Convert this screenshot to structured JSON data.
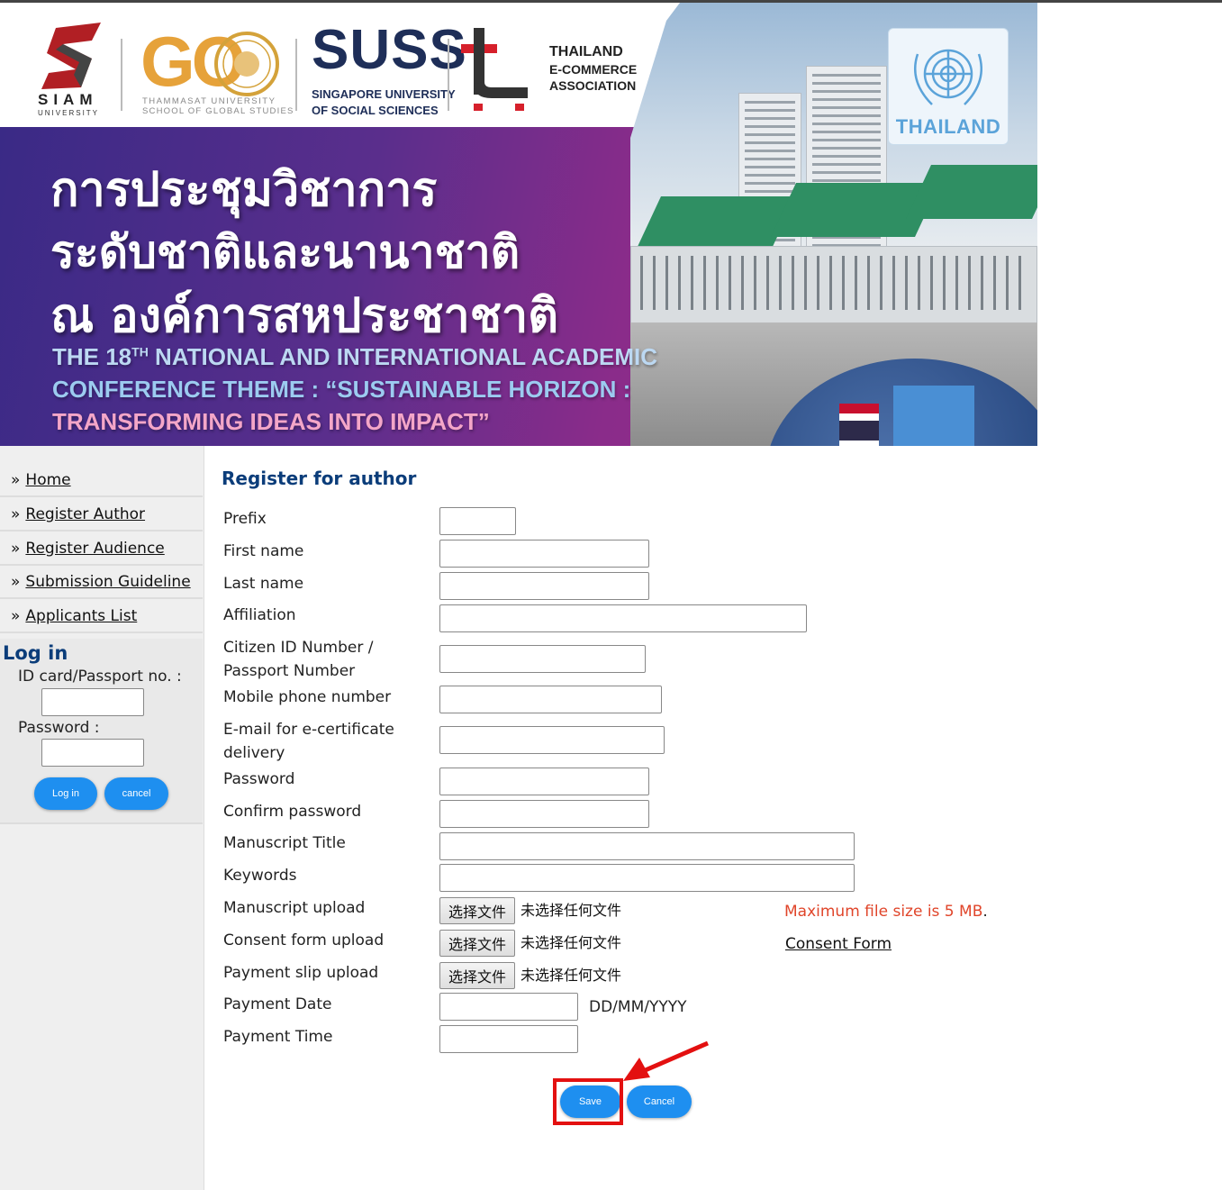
{
  "banner": {
    "logos": {
      "siam_name": "SIAM",
      "siam_sub": "UNIVERSITY",
      "tu_mark": "GO",
      "tu_line1": "THAMMASAT UNIVERSITY",
      "tu_line2": "SCHOOL OF GLOBAL STUDIES",
      "suss_mark": "SUSS",
      "suss_line1": "SINGAPORE UNIVERSITY",
      "suss_line2": "OF SOCIAL SCIENCES",
      "tca_line1": "THAILAND",
      "tca_line2": "E-COMMERCE",
      "tca_line3": "ASSOCIATION",
      "un_label": "THAILAND"
    },
    "thai_line1": "การประชุมวิชาการ",
    "thai_line2": "ระดับชาติและนานาชาติ",
    "thai_line3": "ณ องค์การสหประชาชาติ",
    "en_line1_pre": "THE 18",
    "en_line1_sup": "TH",
    "en_line1_post": " NATIONAL AND INTERNATIONAL ACADEMIC",
    "en_line2": "CONFERENCE THEME : “SUSTAINABLE HORIZON :",
    "en_line3": "TRANSFORMING IDEAS INTO IMPACT”"
  },
  "sidebar": {
    "bullet": "»",
    "items": [
      {
        "label": "Home"
      },
      {
        "label": "Register Author"
      },
      {
        "label": "Register Audience"
      },
      {
        "label": "Submission Guideline"
      },
      {
        "label": "Applicants List"
      }
    ],
    "login": {
      "title": "Log in",
      "id_label": "ID card/Passport no. :",
      "password_label": "Password :",
      "login_button": "Log in",
      "cancel_button": "cancel"
    }
  },
  "form": {
    "title": "Register for author",
    "fields": {
      "prefix": "Prefix",
      "first_name": "First name",
      "last_name": "Last name",
      "affiliation": "Affiliation",
      "citizen_id_l1": "Citizen ID Number /",
      "citizen_id_l2": "Passport Number",
      "mobile": "Mobile phone number",
      "email_l1": "E-mail for e-certificate",
      "email_l2": "delivery",
      "password": "Password",
      "confirm_password": "Confirm password",
      "manuscript_title": "Manuscript Title",
      "keywords": "Keywords",
      "manuscript_upload": "Manuscript upload",
      "consent_upload": "Consent form upload",
      "payment_slip_upload": "Payment slip upload",
      "payment_date": "Payment Date",
      "payment_time": "Payment Time"
    },
    "file_button": "选择文件",
    "file_none": "未选择任何文件",
    "max_size_note": "Maximum file size is 5 MB",
    "max_size_dot": ".",
    "consent_link": "Consent Form",
    "date_format": "DD/MM/YYYY",
    "save_button": "Save",
    "cancel_button": "Cancel"
  },
  "colors": {
    "accent_blue": "#1e8ff0",
    "title_navy": "#0b3d7a",
    "note_red": "#e0452a",
    "highlight_red": "#e31010"
  }
}
